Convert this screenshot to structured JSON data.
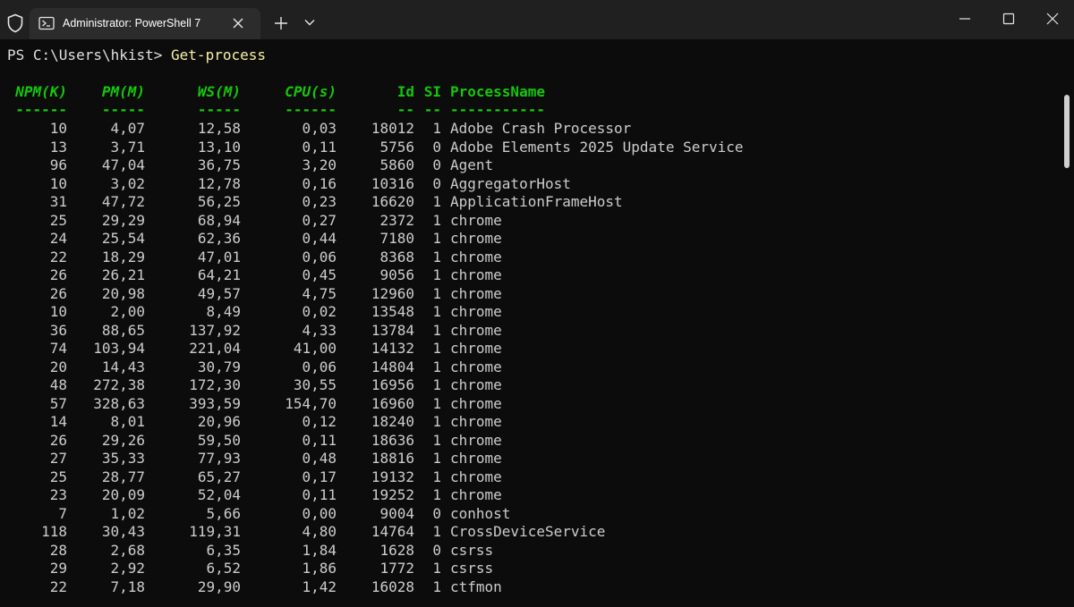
{
  "window": {
    "tab_title": "Administrator: PowerShell 7",
    "icons": [
      "shield-icon",
      "powershell-icon",
      "close-icon",
      "plus-icon",
      "chevron-down-icon",
      "minimize-icon",
      "maximize-icon",
      "window-close-icon"
    ]
  },
  "terminal": {
    "prompt": "PS C:\\Users\\hkist> ",
    "command": "Get-process",
    "colors": {
      "background": "#0c0c0c",
      "header": "#16c60c",
      "text": "#cccccc",
      "command": "#f9f1a5"
    },
    "headers": {
      "npm": "NPM(K)",
      "pm": "PM(M)",
      "ws": "WS(M)",
      "cpu": "CPU(s)",
      "id": "Id",
      "si": "SI",
      "name": "ProcessName"
    },
    "underlines": {
      "npm": "------",
      "pm": "-----",
      "ws": "-----",
      "cpu": "------",
      "id": "--",
      "si": "--",
      "name": "-----------"
    },
    "rows": [
      {
        "npm": "10",
        "pm": "4,07",
        "ws": "12,58",
        "cpu": "0,03",
        "id": "18012",
        "si": "1",
        "name": "Adobe Crash Processor"
      },
      {
        "npm": "13",
        "pm": "3,71",
        "ws": "13,10",
        "cpu": "0,11",
        "id": "5756",
        "si": "0",
        "name": "Adobe Elements 2025 Update Service"
      },
      {
        "npm": "96",
        "pm": "47,04",
        "ws": "36,75",
        "cpu": "3,20",
        "id": "5860",
        "si": "0",
        "name": "Agent"
      },
      {
        "npm": "10",
        "pm": "3,02",
        "ws": "12,78",
        "cpu": "0,16",
        "id": "10316",
        "si": "0",
        "name": "AggregatorHost"
      },
      {
        "npm": "31",
        "pm": "47,72",
        "ws": "56,25",
        "cpu": "0,23",
        "id": "16620",
        "si": "1",
        "name": "ApplicationFrameHost"
      },
      {
        "npm": "25",
        "pm": "29,29",
        "ws": "68,94",
        "cpu": "0,27",
        "id": "2372",
        "si": "1",
        "name": "chrome"
      },
      {
        "npm": "24",
        "pm": "25,54",
        "ws": "62,36",
        "cpu": "0,44",
        "id": "7180",
        "si": "1",
        "name": "chrome"
      },
      {
        "npm": "22",
        "pm": "18,29",
        "ws": "47,01",
        "cpu": "0,06",
        "id": "8368",
        "si": "1",
        "name": "chrome"
      },
      {
        "npm": "26",
        "pm": "26,21",
        "ws": "64,21",
        "cpu": "0,45",
        "id": "9056",
        "si": "1",
        "name": "chrome"
      },
      {
        "npm": "26",
        "pm": "20,98",
        "ws": "49,57",
        "cpu": "4,75",
        "id": "12960",
        "si": "1",
        "name": "chrome"
      },
      {
        "npm": "10",
        "pm": "2,00",
        "ws": "8,49",
        "cpu": "0,02",
        "id": "13548",
        "si": "1",
        "name": "chrome"
      },
      {
        "npm": "36",
        "pm": "88,65",
        "ws": "137,92",
        "cpu": "4,33",
        "id": "13784",
        "si": "1",
        "name": "chrome"
      },
      {
        "npm": "74",
        "pm": "103,94",
        "ws": "221,04",
        "cpu": "41,00",
        "id": "14132",
        "si": "1",
        "name": "chrome"
      },
      {
        "npm": "20",
        "pm": "14,43",
        "ws": "30,79",
        "cpu": "0,06",
        "id": "14804",
        "si": "1",
        "name": "chrome"
      },
      {
        "npm": "48",
        "pm": "272,38",
        "ws": "172,30",
        "cpu": "30,55",
        "id": "16956",
        "si": "1",
        "name": "chrome"
      },
      {
        "npm": "57",
        "pm": "328,63",
        "ws": "393,59",
        "cpu": "154,70",
        "id": "16960",
        "si": "1",
        "name": "chrome"
      },
      {
        "npm": "14",
        "pm": "8,01",
        "ws": "20,96",
        "cpu": "0,12",
        "id": "18240",
        "si": "1",
        "name": "chrome"
      },
      {
        "npm": "26",
        "pm": "29,26",
        "ws": "59,50",
        "cpu": "0,11",
        "id": "18636",
        "si": "1",
        "name": "chrome"
      },
      {
        "npm": "27",
        "pm": "35,33",
        "ws": "77,93",
        "cpu": "0,48",
        "id": "18816",
        "si": "1",
        "name": "chrome"
      },
      {
        "npm": "25",
        "pm": "28,77",
        "ws": "65,27",
        "cpu": "0,17",
        "id": "19132",
        "si": "1",
        "name": "chrome"
      },
      {
        "npm": "23",
        "pm": "20,09",
        "ws": "52,04",
        "cpu": "0,11",
        "id": "19252",
        "si": "1",
        "name": "chrome"
      },
      {
        "npm": "7",
        "pm": "1,02",
        "ws": "5,66",
        "cpu": "0,00",
        "id": "9004",
        "si": "0",
        "name": "conhost"
      },
      {
        "npm": "118",
        "pm": "30,43",
        "ws": "119,31",
        "cpu": "4,80",
        "id": "14764",
        "si": "1",
        "name": "CrossDeviceService"
      },
      {
        "npm": "28",
        "pm": "2,68",
        "ws": "6,35",
        "cpu": "1,84",
        "id": "1628",
        "si": "0",
        "name": "csrss"
      },
      {
        "npm": "29",
        "pm": "2,92",
        "ws": "6,52",
        "cpu": "1,86",
        "id": "1772",
        "si": "1",
        "name": "csrss"
      },
      {
        "npm": "22",
        "pm": "7,18",
        "ws": "29,90",
        "cpu": "1,42",
        "id": "16028",
        "si": "1",
        "name": "ctfmon"
      }
    ]
  }
}
